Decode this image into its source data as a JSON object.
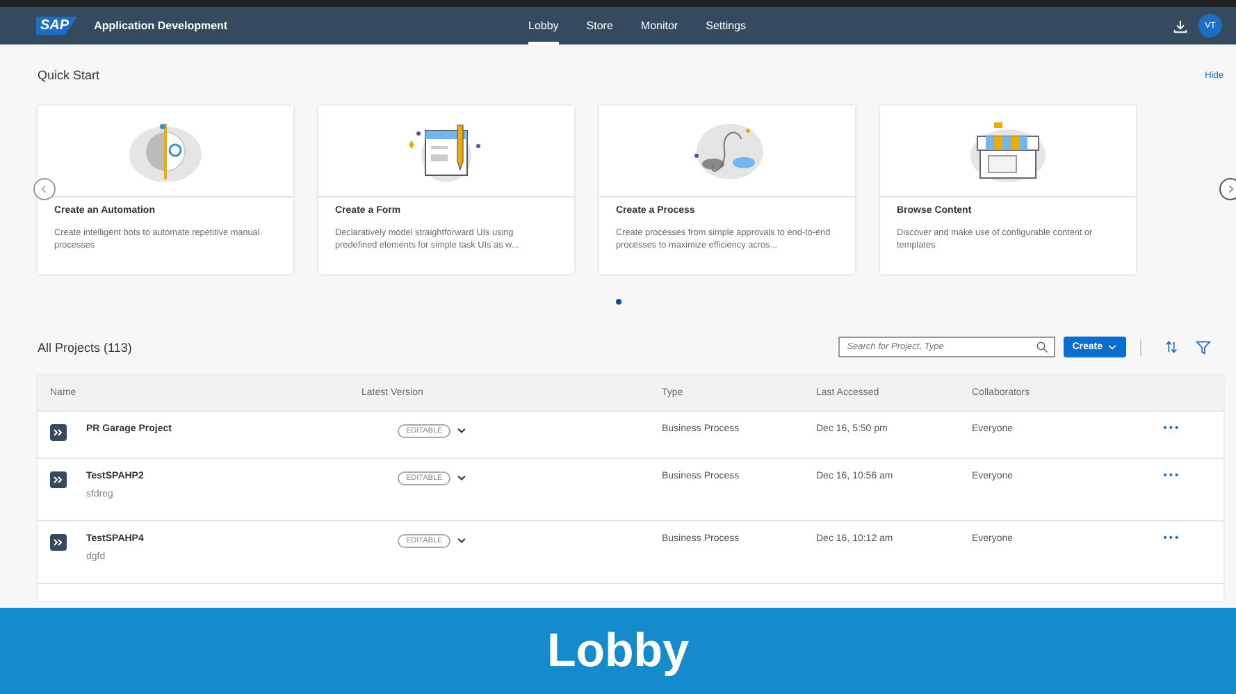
{
  "shell": {
    "logo": "SAP",
    "title": "Application Development",
    "avatar": "VT"
  },
  "tabs": [
    {
      "label": "Lobby",
      "selected": true
    },
    {
      "label": "Store",
      "selected": false
    },
    {
      "label": "Monitor",
      "selected": false
    },
    {
      "label": "Settings",
      "selected": false
    }
  ],
  "quick_start": {
    "title": "Quick Start",
    "hide": "Hide",
    "cards": [
      {
        "kind": "automation",
        "title": "Create an Automation",
        "description": "Create intelligent bots to automate repetitive manual processes"
      },
      {
        "kind": "form",
        "title": "Create a Form",
        "description": "Declaratively model straightforward UIs using predefined elements for simple task UIs as w..."
      },
      {
        "kind": "process",
        "title": "Create a Process",
        "description": "Create processes from simple approvals to end-to-end processes to maximize efficiency acros..."
      },
      {
        "kind": "content",
        "title": "Browse Content",
        "description": "Discover and make use of configurable content or templates"
      }
    ],
    "pages": [
      {
        "selected": true
      }
    ]
  },
  "projects": {
    "title": "All Projects (113)",
    "search": {
      "placeholder": "Search for Project, Type"
    },
    "create": "Create",
    "columns": [
      "Name",
      "Latest Version",
      "Type",
      "Last Accessed",
      "Collaborators"
    ],
    "rows": [
      {
        "name": "PR Garage Project",
        "description": "",
        "version": "EDITABLE",
        "type": "Business Process",
        "accessed": "Dec 16, 5:50 pm",
        "collaborators": "Everyone",
        "more": "•••"
      },
      {
        "name": "TestSPAHP2",
        "description": "sfdreg",
        "version": "EDITABLE",
        "type": "Business Process",
        "accessed": "Dec 16, 10:56 am",
        "collaborators": "Everyone",
        "more": "•••"
      },
      {
        "name": "TestSPAHP4",
        "description": "dgfd",
        "version": "EDITABLE",
        "type": "Business Process",
        "accessed": "Dec 16, 10:12 am",
        "collaborators": "Everyone",
        "more": "•••"
      }
    ]
  },
  "banner": {
    "title": "Lobby"
  }
}
